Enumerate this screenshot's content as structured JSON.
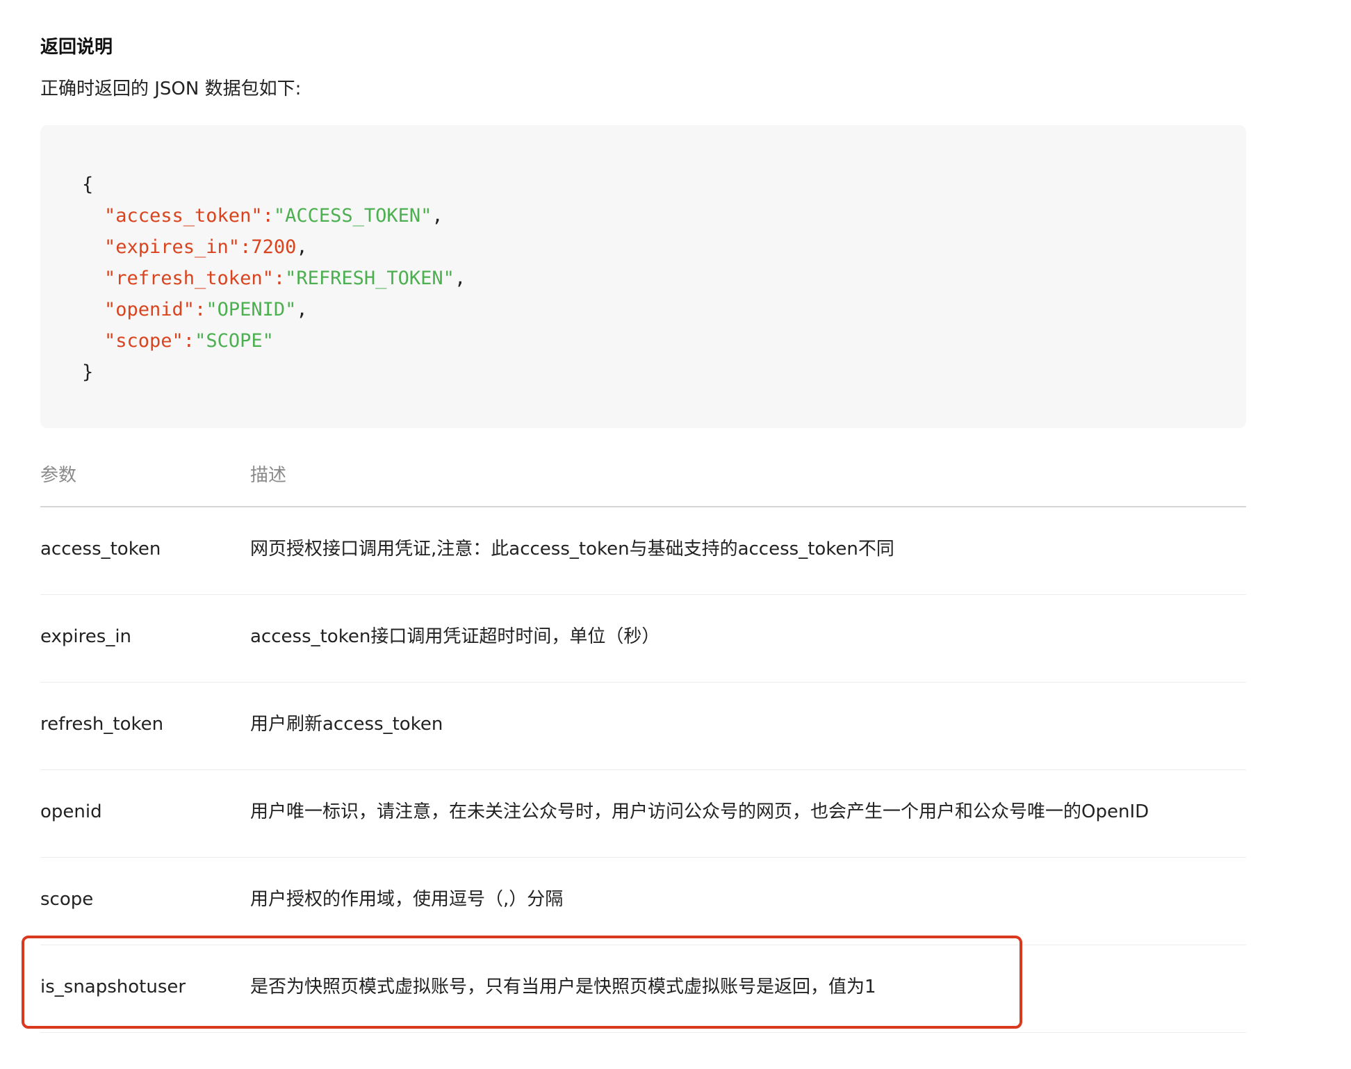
{
  "section": {
    "title": "返回说明",
    "description": "正确时返回的 JSON 数据包如下:"
  },
  "code": {
    "open_brace": "{",
    "close_brace": "}",
    "lines": [
      {
        "key": "\"access_token\"",
        "sep": ":",
        "value": "\"ACCESS_TOKEN\"",
        "value_type": "string",
        "trail": ","
      },
      {
        "key": "\"expires_in\"",
        "sep": ":",
        "value": "7200",
        "value_type": "number",
        "trail": ","
      },
      {
        "key": "\"refresh_token\"",
        "sep": ":",
        "value": "\"REFRESH_TOKEN\"",
        "value_type": "string",
        "trail": ","
      },
      {
        "key": "\"openid\"",
        "sep": ":",
        "value": "\"OPENID\"",
        "value_type": "string",
        "trail": ","
      },
      {
        "key": "\"scope\"",
        "sep": ":",
        "value": "\"SCOPE\"",
        "value_type": "string",
        "trail": ""
      }
    ],
    "colors": {
      "key": "#d9431e",
      "string": "#4caf50",
      "number": "#d9431e"
    }
  },
  "table": {
    "headers": {
      "param": "参数",
      "desc": "描述"
    },
    "rows": [
      {
        "param": "access_token",
        "desc": "网页授权接口调用凭证,注意：此access_token与基础支持的access_token不同"
      },
      {
        "param": "expires_in",
        "desc": "access_token接口调用凭证超时时间，单位（秒）"
      },
      {
        "param": "refresh_token",
        "desc": "用户刷新access_token"
      },
      {
        "param": "openid",
        "desc": "用户唯一标识，请注意，在未关注公众号时，用户访问公众号的网页，也会产生一个用户和公众号唯一的OpenID"
      },
      {
        "param": "scope",
        "desc": "用户授权的作用域，使用逗号（,）分隔"
      },
      {
        "param": "is_snapshotuser",
        "desc": "是否为快照页模式虚拟账号，只有当用户是快照页模式虚拟账号是返回，值为1"
      }
    ]
  },
  "highlight": {
    "color": "#d93a1f",
    "target_row": "is_snapshotuser"
  }
}
